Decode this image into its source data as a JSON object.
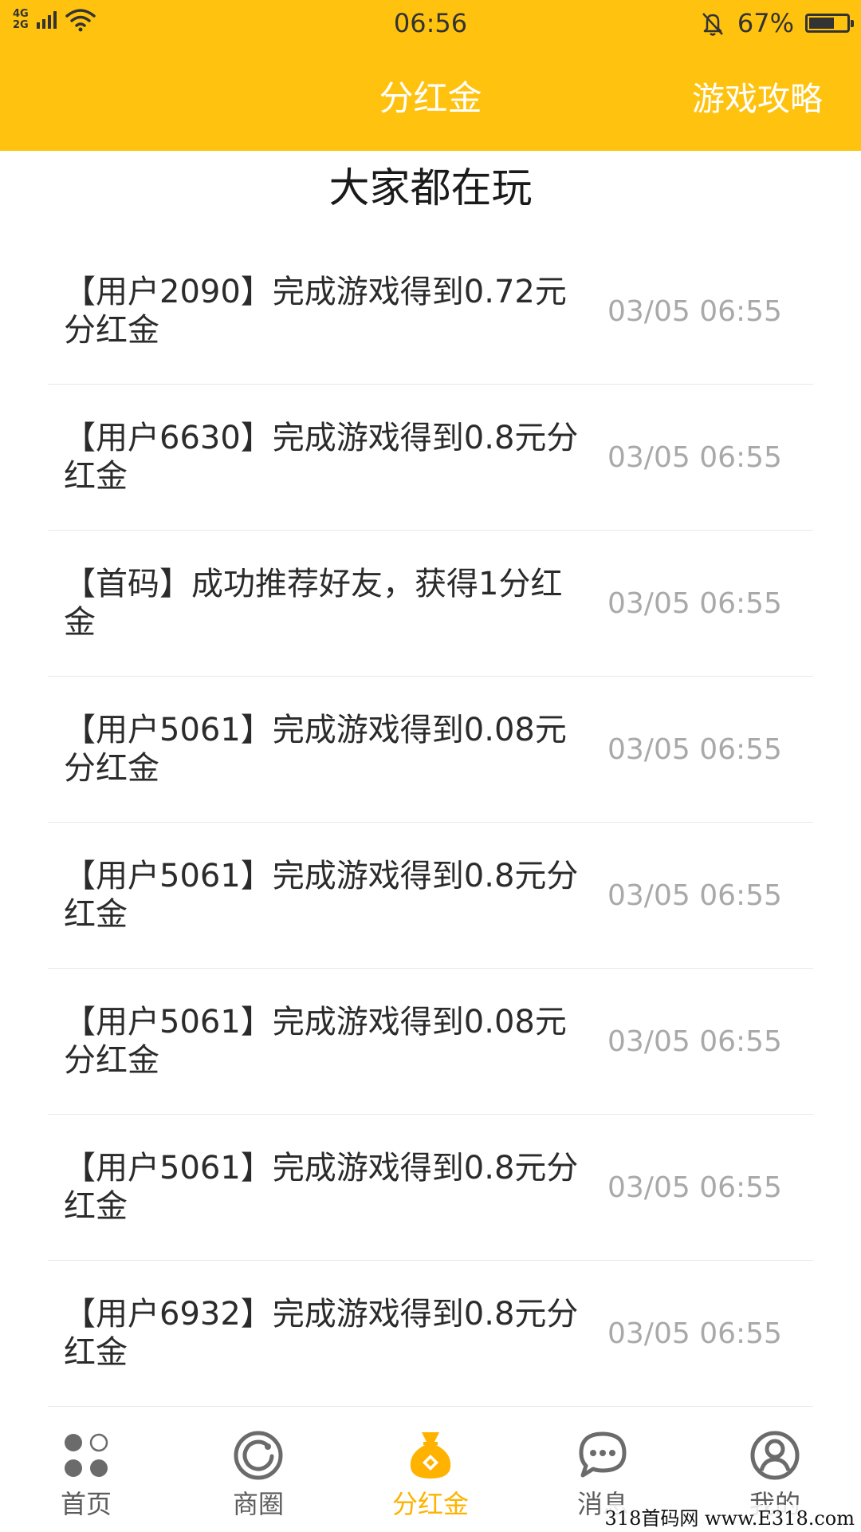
{
  "status_bar": {
    "network_top": "4G",
    "network_bottom": "2G",
    "time": "06:56",
    "battery_percent": "67%",
    "battery_level": 0.67
  },
  "header": {
    "title": "分红金",
    "right_link": "游戏攻略"
  },
  "section": {
    "title": "大家都在玩"
  },
  "feed": [
    {
      "text": "【用户2090】完成游戏得到0.72元分红金",
      "time": "03/05 06:55"
    },
    {
      "text": "【用户6630】完成游戏得到0.8元分红金",
      "time": "03/05 06:55"
    },
    {
      "text": "【首码】成功推荐好友，获得1分红金",
      "time": "03/05 06:55"
    },
    {
      "text": "【用户5061】完成游戏得到0.08元分红金",
      "time": "03/05 06:55"
    },
    {
      "text": "【用户5061】完成游戏得到0.8元分红金",
      "time": "03/05 06:55"
    },
    {
      "text": "【用户5061】完成游戏得到0.08元分红金",
      "time": "03/05 06:55"
    },
    {
      "text": "【用户5061】完成游戏得到0.8元分红金",
      "time": "03/05 06:55"
    },
    {
      "text": "【用户6932】完成游戏得到0.8元分红金",
      "time": "03/05 06:55"
    }
  ],
  "tabbar": {
    "items": [
      {
        "label": "首页",
        "icon": "home-dots-icon"
      },
      {
        "label": "商圈",
        "icon": "business-circle-icon"
      },
      {
        "label": "分红金",
        "icon": "money-bag-icon",
        "active": true
      },
      {
        "label": "消息",
        "icon": "message-bubble-icon"
      },
      {
        "label": "我的",
        "icon": "user-profile-icon"
      }
    ]
  },
  "colors": {
    "brand": "#FFC20E",
    "active_tab": "#FFB300",
    "time_text": "#A9A9A9",
    "tab_icon": "#6b6b6b"
  },
  "watermark": "318首码网 www.E318.com"
}
